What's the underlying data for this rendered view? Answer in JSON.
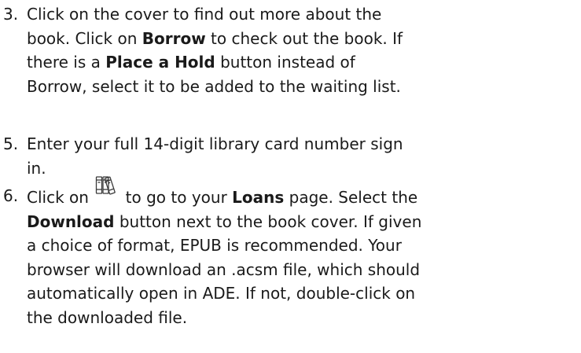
{
  "steps": [
    {
      "number": "3.",
      "line1": "Click on the cover to find out more about the",
      "line2_a": "book. Click on ",
      "line2_bold": "Borrow",
      "line2_b": " to check out the book. If",
      "line3_a": "there is a ",
      "line3_bold": "Place a Hold",
      "line3_b": " button instead of",
      "line4": "Borrow, select it to be added to the waiting list."
    },
    {
      "number": "5.",
      "line1": "Enter your full 14-digit library card number sign",
      "line2": "in."
    },
    {
      "number": "6.",
      "line1_a": "Click on ",
      "icon": "books-loans-icon",
      "line1_b": " to go to your ",
      "line1_bold": "Loans",
      "line1_c": " page. Select the",
      "line2_bold": "Download",
      "line2_b": " button next to the book cover. If given",
      "line3": "a choice of format, EPUB is recommended. Your",
      "line4": "browser will download an .acsm file, which should",
      "line5": "automatically open in ADE. If not, double-click on",
      "line6": "the downloaded file."
    }
  ]
}
